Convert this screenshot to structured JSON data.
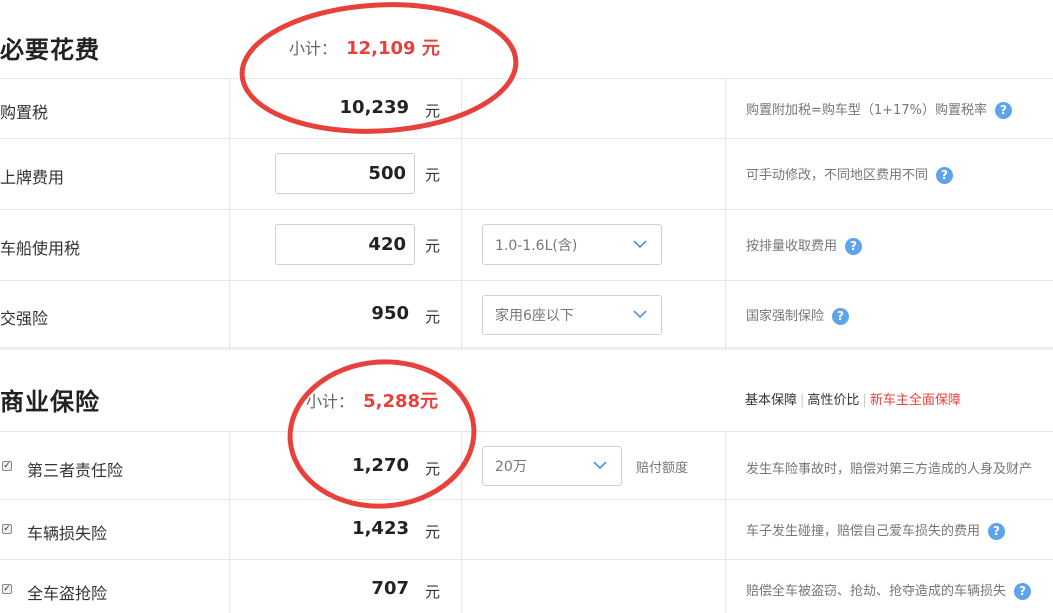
{
  "required": {
    "title": "必要花费",
    "subtotal_label": "小计：",
    "subtotal_value": "12,109 元",
    "rows": [
      {
        "label": "购置税",
        "value": "10,239",
        "unit": "元",
        "note": "购置附加税=购车型（1+17%）购置税率",
        "help": "?"
      },
      {
        "label": "上牌费用",
        "value": "500",
        "unit": "元",
        "note": "可手动修改，不同地区费用不同",
        "help": "?"
      },
      {
        "label": "车船使用税",
        "value": "420",
        "unit": "元",
        "select": "1.0-1.6L(含)",
        "note": "按排量收取费用",
        "help": "?"
      },
      {
        "label": "交强险",
        "value": "950",
        "unit": "元",
        "select": "家用6座以下",
        "note": "国家强制保险",
        "help": "?"
      }
    ]
  },
  "commercial": {
    "title": "商业保险",
    "subtotal_label": "小计：",
    "subtotal_value": "5,288元",
    "links": [
      "基本保障",
      "高性价比",
      "新车主全面保障"
    ],
    "rows": [
      {
        "label": "第三者责任险",
        "value": "1,270",
        "unit": "元",
        "select": "20万",
        "select_suffix": "赔付额度",
        "note": "发生车险事故时，赔偿对第三方造成的人身及财产",
        "checked": true
      },
      {
        "label": "车辆损失险",
        "value": "1,423",
        "unit": "元",
        "note": "车子发生碰撞，赔偿自己爱车损失的费用",
        "help": "?",
        "checked": true
      },
      {
        "label": "全车盗抢险",
        "value": "707",
        "unit": "元",
        "note": "赔偿全车被盗窃、抢劫、抢夺造成的车辆损失",
        "help": "?",
        "checked": true
      }
    ]
  },
  "colors": {
    "accent": "#e8413c",
    "help_icon": "#5ea4ec",
    "annotation": "#e8413c"
  },
  "icons": {
    "chevron": "chevron-down-icon",
    "help": "help-circle-icon",
    "checkbox": "checkbox-checked-icon"
  }
}
